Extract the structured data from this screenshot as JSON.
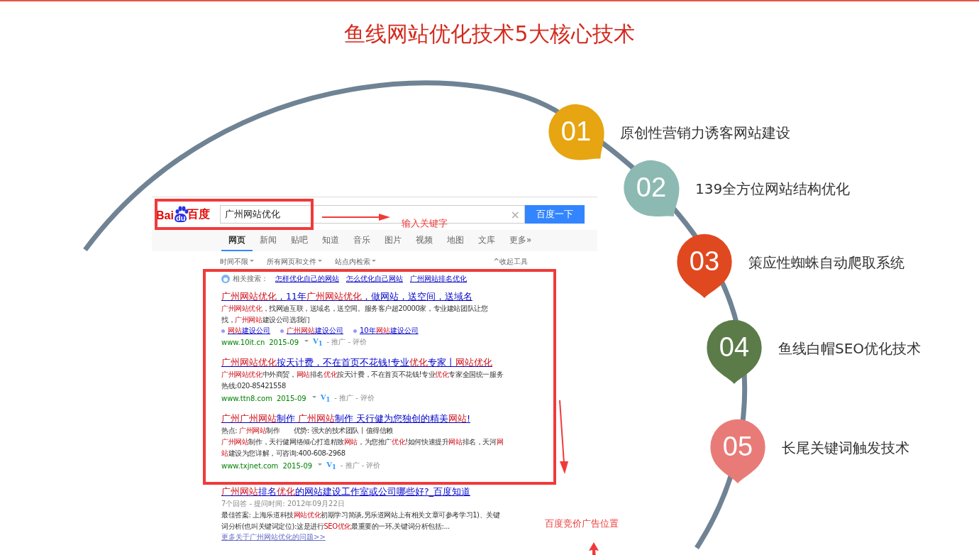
{
  "title": "鱼线网站优化技术5大核心技术",
  "steps": [
    {
      "number": "01",
      "label": "原创性营销力诱客网站建设",
      "color": "#e6a511"
    },
    {
      "number": "02",
      "label": "139全方位网站结构优化",
      "color": "#8cbab3"
    },
    {
      "number": "03",
      "label": "策应性蜘蛛自动爬取系统",
      "color": "#e0481f"
    },
    {
      "number": "04",
      "label": "鱼线白帽SEO优化技术",
      "color": "#5b7b48"
    },
    {
      "number": "05",
      "label": "长尾关键词触发技术",
      "color": "#e87b78"
    }
  ],
  "screenshot": {
    "logo": {
      "left": "Bai",
      "paw": "du",
      "right": "百度"
    },
    "search": {
      "value": "广州网站优化",
      "clear": "×",
      "button": "百度一下"
    },
    "annotation_keyword": "输入关键字",
    "annotation_ads": "百度竞价广告位置",
    "tabs": [
      {
        "label": "网页",
        "selected": true
      },
      {
        "label": "新闻",
        "selected": false
      },
      {
        "label": "贴吧",
        "selected": false
      },
      {
        "label": "知道",
        "selected": false
      },
      {
        "label": "音乐",
        "selected": false
      },
      {
        "label": "图片",
        "selected": false
      },
      {
        "label": "视频",
        "selected": false
      },
      {
        "label": "地图",
        "selected": false
      },
      {
        "label": "文库",
        "selected": false
      },
      {
        "label": "更多»",
        "selected": false
      }
    ],
    "filters": [
      "时间不限",
      "所有网页和文件",
      "站点内检索"
    ],
    "collapse_tools": "^收起工具",
    "related": {
      "label": "相关搜索：",
      "links": [
        "怎样优化自己的网站",
        "怎么优化自己网站",
        "广州网站排名优化"
      ]
    },
    "ads": [
      {
        "title": [
          {
            "text": "广州网站优化",
            "highlight": true
          },
          {
            "text": "，11年",
            "highlight": false
          },
          {
            "text": "广州网站优化",
            "highlight": true
          },
          {
            "text": "，做网站，送空间，送域名",
            "highlight": false
          }
        ],
        "snippet": [
          [
            {
              "text": "广州网站优化",
              "highlight": true
            },
            {
              "text": "，找网迪互联，送域名，送空间。服务客户超20000家，专业建站团队让您",
              "highlight": false
            }
          ],
          [
            {
              "text": "找，",
              "highlight": false
            },
            {
              "text": "广州网站",
              "highlight": true
            },
            {
              "text": "建设公司选我们",
              "highlight": false
            }
          ]
        ],
        "sitelinks": [
          [
            {
              "text": "网站",
              "highlight": true
            },
            {
              "text": "建设公司",
              "highlight": false
            }
          ],
          [
            {
              "text": "广州网站",
              "highlight": true
            },
            {
              "text": "建设公司",
              "highlight": false
            }
          ],
          [
            {
              "text": "10年",
              "highlight": false
            },
            {
              "text": "网站",
              "highlight": true
            },
            {
              "text": "建设公司",
              "highlight": false
            }
          ]
        ],
        "url": "www.10it.cn",
        "date": "2015-09",
        "badge": "V$_{1}$",
        "meta": "- 推广 - 评价"
      },
      {
        "title": [
          {
            "text": "广州网站优化",
            "highlight": true
          },
          {
            "text": "按天计费，不在首页不花钱!专业",
            "highlight": false
          },
          {
            "text": "优化",
            "highlight": true
          },
          {
            "text": "专家丨",
            "highlight": false
          },
          {
            "text": "网站优化",
            "highlight": true
          }
        ],
        "snippet": [
          [
            {
              "text": "广州网站优化",
              "highlight": true
            },
            {
              "text": "中外商贸，",
              "highlight": false
            },
            {
              "text": "网站",
              "highlight": true
            },
            {
              "text": "排名",
              "highlight": false
            },
            {
              "text": "优化",
              "highlight": true
            },
            {
              "text": "按天计费，不在首页不花钱!专业",
              "highlight": false
            },
            {
              "text": "优化",
              "highlight": true
            },
            {
              "text": "专家全国统一服务",
              "highlight": false
            }
          ],
          [
            {
              "text": "热线:020-85421558",
              "highlight": false
            }
          ]
        ],
        "url": "www.ttn8.com",
        "date": "2015-09",
        "badge": "V$_{1}$",
        "meta": "- 推广 - 评价"
      },
      {
        "title": [
          {
            "text": "广州广州网站",
            "highlight": true
          },
          {
            "text": "制作 ",
            "highlight": false
          },
          {
            "text": "广州网站",
            "highlight": true
          },
          {
            "text": "制作 天行健为您独创的精美",
            "highlight": false
          },
          {
            "text": "网站",
            "highlight": true
          },
          {
            "text": "!",
            "highlight": false
          }
        ],
        "snippet": [
          [
            {
              "text": "热点: ",
              "highlight": false
            },
            {
              "text": "广州网站",
              "highlight": true
            },
            {
              "text": "制作　　优势: 强大的技术团队丨值得信赖",
              "highlight": false
            }
          ],
          [
            {
              "text": "广州网站",
              "highlight": true
            },
            {
              "text": "制作，天行健网络倾心打造精致",
              "highlight": false
            },
            {
              "text": "网站",
              "highlight": true
            },
            {
              "text": "，为您推广",
              "highlight": false
            },
            {
              "text": "优化",
              "highlight": true
            },
            {
              "text": "!如何快速提升",
              "highlight": false
            },
            {
              "text": "网站",
              "highlight": true
            },
            {
              "text": "排名，天河",
              "highlight": false
            },
            {
              "text": "网",
              "highlight": true
            }
          ],
          [
            {
              "text": "站",
              "highlight": true
            },
            {
              "text": "建设为您详解，可咨询:400-608-2968",
              "highlight": false
            }
          ]
        ],
        "url": "www.txjnet.com",
        "date": "2015-09",
        "badge": "V$_{1}$",
        "meta": "- 推广 - 评价"
      }
    ],
    "organic": {
      "title": [
        {
          "text": "广州网站",
          "highlight": true
        },
        {
          "text": "排名",
          "highlight": false
        },
        {
          "text": "优化",
          "highlight": true
        },
        {
          "text": "的网站建设工作室或公司哪些好?_百度知道",
          "highlight": false
        }
      ],
      "meta": "7个回答 - 提问时间: 2012年09月22日",
      "snippet": [
        [
          {
            "text": "最佳答案: 上海乐道科技",
            "highlight": false
          },
          {
            "text": "网站优化",
            "highlight": true
          },
          {
            "text": "初期学习简谈,另乐道网站上有相关文章可参考学习1)、关键",
            "highlight": false
          }
        ],
        [
          {
            "text": "词分析(也叫关键词定位):这是进行",
            "highlight": false
          },
          {
            "text": "SEO优化",
            "highlight": true
          },
          {
            "text": "最重要的一环,关键词分析包括:...",
            "highlight": false
          }
        ]
      ],
      "more": "更多关于广州网站优化的问题>>"
    }
  }
}
